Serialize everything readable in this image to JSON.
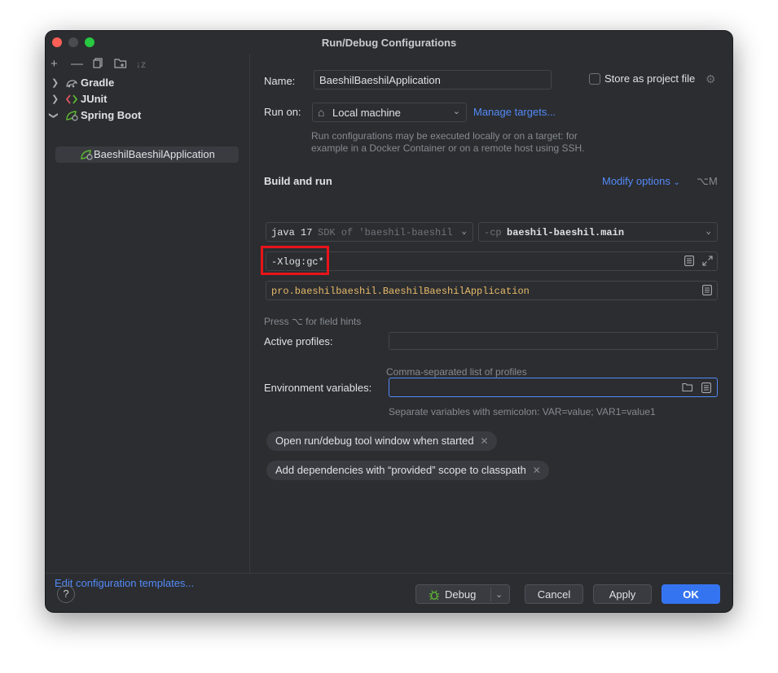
{
  "window": {
    "title": "Run/Debug Configurations"
  },
  "left_panel": {
    "toolbar_icons": [
      "add-icon",
      "remove-icon",
      "copy-icon",
      "new-folder-icon",
      "sort-icon"
    ],
    "tree": [
      {
        "label": "Gradle",
        "icon": "gradle-icon",
        "expanded": false
      },
      {
        "label": "JUnit",
        "icon": "junit-icon",
        "expanded": false
      },
      {
        "label": "Spring Boot",
        "icon": "spring-boot-icon",
        "expanded": true,
        "children": [
          {
            "label": "BaeshilBaeshilApplication",
            "selected": true
          }
        ]
      }
    ],
    "edit_templates": "Edit configuration templates..."
  },
  "form": {
    "name_label": "Name:",
    "name_value": "BaeshilBaeshilApplication",
    "store_label": "Store as project file",
    "store_checked": false,
    "run_on_label": "Run on:",
    "run_on_value": "Local machine",
    "manage_targets": "Manage targets...",
    "run_on_hint": "Run configurations may be executed locally or on a target: for example in a Docker Container or on a remote host using SSH.",
    "section_title": "Build and run",
    "modify_options": "Modify options",
    "modify_shortcut": "⌥M",
    "sdk_main": "java 17",
    "sdk_detail": "SDK of 'baeshil-baeshil.",
    "cp_flag": "-cp",
    "cp_value": "baeshil-baeshil.main",
    "vm_options": "-Xlog:gc*",
    "main_class": "pro.baeshilbaeshil.BaeshilBaeshilApplication",
    "field_hints": "Press ⌥ for field hints",
    "profiles_label": "Active profiles:",
    "profiles_value": "",
    "profiles_hint": "Comma-separated list of profiles",
    "env_label": "Environment variables:",
    "env_value": "",
    "env_hint": "Separate variables with semicolon: VAR=value; VAR1=value1",
    "chips": [
      "Open run/debug tool window when started",
      "Add dependencies with “provided” scope to classpath"
    ]
  },
  "footer": {
    "help": "?",
    "debug": "Debug",
    "cancel": "Cancel",
    "apply": "Apply",
    "ok": "OK"
  },
  "colors": {
    "background": "#2b2d30",
    "accent": "#548af7",
    "primary_button": "#3574f0",
    "highlight_box": "#e8141a"
  }
}
